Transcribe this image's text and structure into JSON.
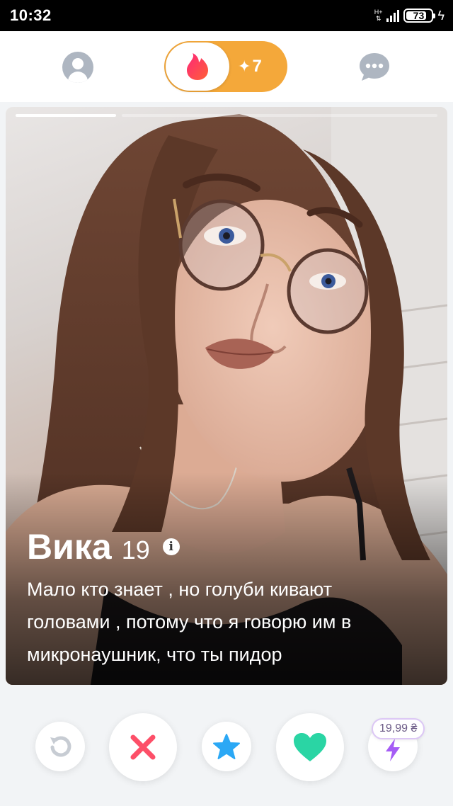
{
  "status_bar": {
    "time": "10:32",
    "network_label": "H+",
    "battery_level": "73"
  },
  "top_nav": {
    "gold_count": "7",
    "colors": {
      "brand": "#fe3c72",
      "gold": "#f4a83a",
      "inactive": "#aeb6c1"
    }
  },
  "card": {
    "photo_count_visible": 2,
    "active_photo": 1,
    "name": "Вика",
    "age": "19",
    "bio_lines": [
      "Мало кто знает , но голуби кивают",
      "головами , потому что я говорю им в",
      "микронаушник,  что ты пидор"
    ]
  },
  "actions": {
    "boost_price": "19,99 ₴",
    "colors": {
      "nope": "#fd4f68",
      "superlike": "#2ba8f5",
      "like": "#2ad5a4",
      "boost": "#a55cf5",
      "rewind": "#c7ccd3"
    }
  }
}
